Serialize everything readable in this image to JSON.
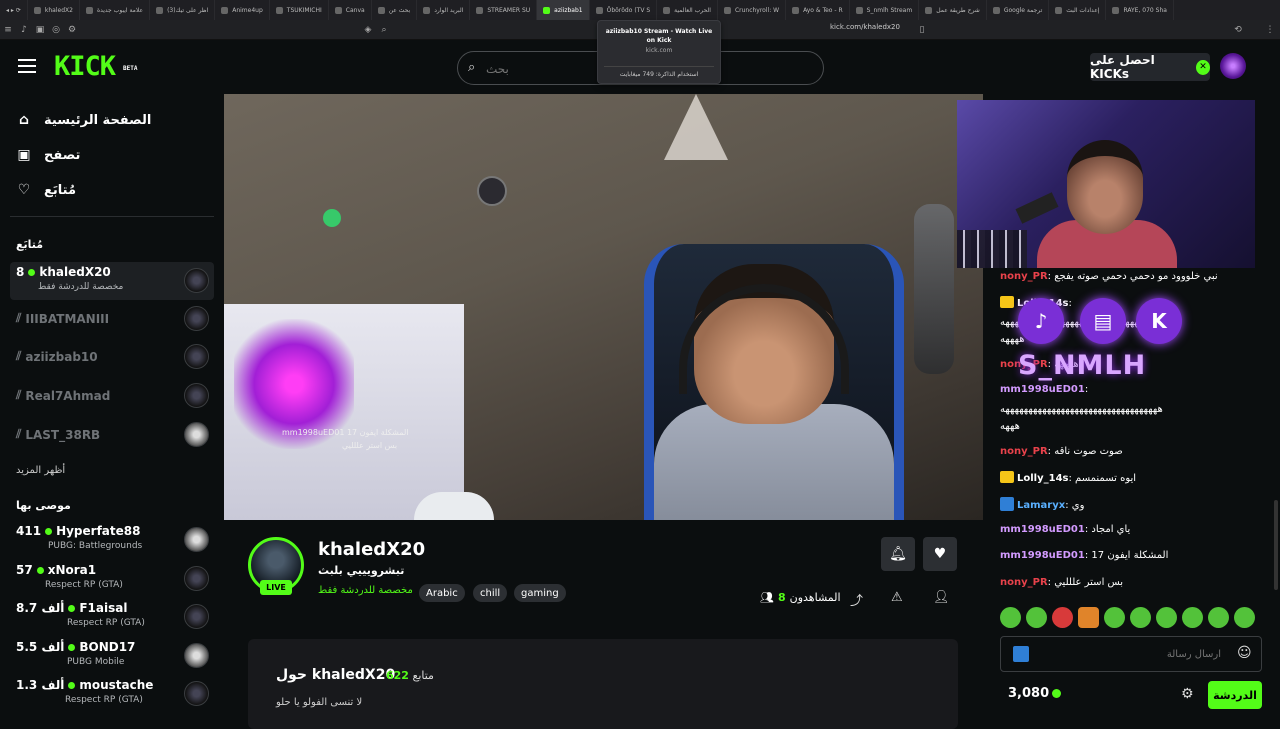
{
  "browser": {
    "tabs": [
      "khaledX2",
      "علامة ايبوب جديدة",
      "(3)اظر على تيك",
      "Anime4up",
      "TSUKIMICHI",
      "Canva",
      "بحث عن",
      "البريد الوارد",
      "STREAMER SU",
      "aziizbab1",
      "Ōbōrōdo (TV S",
      "الحرب العالمية",
      "Crunchyroll: W",
      "Ayo & Teo - R",
      "S_nmlh Stream",
      "شرح طريقة عمل",
      "Google ترجمة",
      "إعدادات البث",
      "RAYE, 070 Sha"
    ],
    "active_tab": "aziizbab1",
    "url": "kick.com/khaledx20",
    "tooltip": {
      "title": "aziizbab10 Stream - Watch Live on Kick",
      "domain": "kick.com",
      "memory": "استخدام الذاكرة: 749 ميغابايت"
    }
  },
  "header": {
    "logo": "KICK",
    "beta": "BETA",
    "search_placeholder": "بحث",
    "kicks_button": "احصل على KICKs"
  },
  "sidebar": {
    "nav": [
      {
        "label": "الصفحة الرئيسية",
        "icon": "home-icon"
      },
      {
        "label": "تصفح",
        "icon": "browse-icon"
      },
      {
        "label": "مُتابَع",
        "icon": "heart-icon"
      }
    ],
    "following_title": "مُتابَع",
    "following": [
      {
        "count": "8",
        "name": "khaledX20",
        "sub": "مخصصة للدردشة فقط",
        "live": true
      },
      {
        "name": "IIIBATMANIII",
        "live": false
      },
      {
        "name": "aziizbab10",
        "live": false
      },
      {
        "name": "Real7Ahmad",
        "live": false
      },
      {
        "name": "LAST_38RB",
        "live": false
      }
    ],
    "show_more": "أظهر المزيد",
    "recommended_title": "موصى بها",
    "recommended": [
      {
        "count": "411",
        "name": "Hyperfate88",
        "sub": "PUBG: Battlegrounds"
      },
      {
        "count": "57",
        "name": "xNora1",
        "sub": "Respect RP (GTA)"
      },
      {
        "count": "8.7 ألف",
        "name": "F1aisal",
        "sub": "Respect RP (GTA)"
      },
      {
        "count": "5.5 ألف",
        "name": "BOND17",
        "sub": "PUBG Mobile"
      },
      {
        "count": "1.3 ألف",
        "name": "moustache",
        "sub": "Respect RP (GTA)"
      }
    ]
  },
  "video": {
    "overlay_line1": "mm1998uED01 المشكلة ايفون 17",
    "overlay_line2": "بس استر عللليي"
  },
  "channel": {
    "name": "khaledX20",
    "live_label": "LIVE",
    "title": "تبشرويييي بلبث",
    "category": "مخصصة للدردشة فقط",
    "tags": [
      "Arabic",
      "chill",
      "gaming"
    ],
    "viewers_count": "8",
    "viewers_label": "المشاهدون",
    "about_title": "حول khaledX20",
    "followers_count": "622",
    "followers_label": "متابع",
    "bio": "لا تنسى الفولو يا حلو"
  },
  "chat": {
    "messages": [
      {
        "user": "nony_PR",
        "color": "red",
        "text": "نبي خلووود مو دحمي دحمي صوته يفجع"
      },
      {
        "user": "Lolly_14s",
        "color": "white",
        "badge": "crown",
        "text": ""
      },
      {
        "user": "",
        "color": "white",
        "text": "هههههههههههههههههههههههههههههههههه"
      },
      {
        "user": "",
        "color": "white",
        "text": "ههههه"
      },
      {
        "user": "nony_PR",
        "color": "red",
        "text": "ههههه"
      },
      {
        "user": "mm1998uED01",
        "color": "purple",
        "text": ""
      },
      {
        "user": "",
        "color": "white",
        "text": "ههههههههههههههههههههههههههههههههههه"
      },
      {
        "user": "",
        "color": "white",
        "text": "هههه"
      },
      {
        "user": "nony_PR",
        "color": "red",
        "text": "صوت صوت ناقه"
      },
      {
        "user": "Lolly_14s",
        "color": "white",
        "badge": "crown",
        "text": "ايوه تسمنمسم"
      },
      {
        "user": "Lamaryx",
        "color": "blue",
        "badge": "hammer",
        "text": "وي"
      },
      {
        "user": "mm1998uED01",
        "color": "purple",
        "text": "ياي امجاد"
      },
      {
        "user": "mm1998uED01",
        "color": "purple",
        "text": "المشكلة ايفون 17"
      },
      {
        "user": "nony_PR",
        "color": "red",
        "text": "بس استر عللليي"
      }
    ],
    "social_handle": "S_NMLH",
    "social_icons": [
      "tiktok-icon",
      "twitch-icon",
      "kick-icon"
    ],
    "input_placeholder": "ارسال رسالة",
    "kicks_balance": "3,080",
    "send_label": "الدردشة"
  },
  "colors": {
    "accent": "#53fc18",
    "background": "#0b0e0f",
    "username_red": "#e8424b",
    "username_purple": "#d39bff"
  }
}
